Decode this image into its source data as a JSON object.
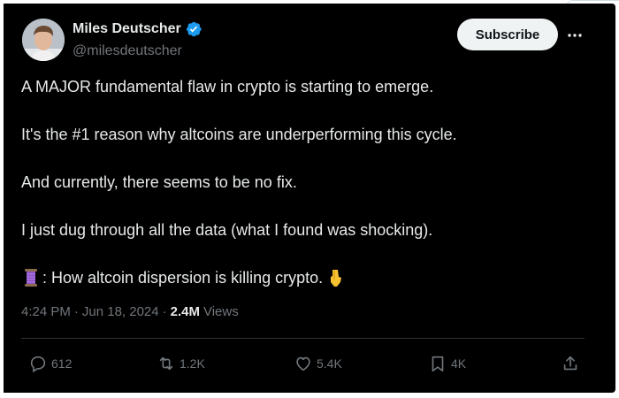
{
  "author": {
    "display_name": "Miles Deutscher",
    "handle": "@milesdeutscher",
    "verified": true
  },
  "header": {
    "subscribe_label": "Subscribe",
    "more_icon": "more-horizontal-icon"
  },
  "post": {
    "paragraphs": [
      "A MAJOR fundamental flaw in crypto is starting to emerge.",
      "It's the #1 reason why altcoins are underperforming this cycle.",
      "And currently, there seems to be no fix.",
      "I just dug through all the data (what I found was shocking).",
      ": How altcoin dispersion is killing crypto."
    ],
    "lead_emoji": "thread-spool-icon",
    "trail_emoji": "pointing-down-icon"
  },
  "meta": {
    "time": "4:24 PM",
    "separator": "·",
    "date": "Jun 18, 2024",
    "views_count": "2.4M",
    "views_label": "Views"
  },
  "actions": {
    "replies": "612",
    "reposts": "1.2K",
    "likes": "5.4K",
    "bookmarks": "4K"
  },
  "colors": {
    "background": "#000000",
    "text": "#e7e9ea",
    "muted": "#71767b",
    "verified": "#1d9bf0",
    "subscribe_bg": "#eff3f4"
  }
}
